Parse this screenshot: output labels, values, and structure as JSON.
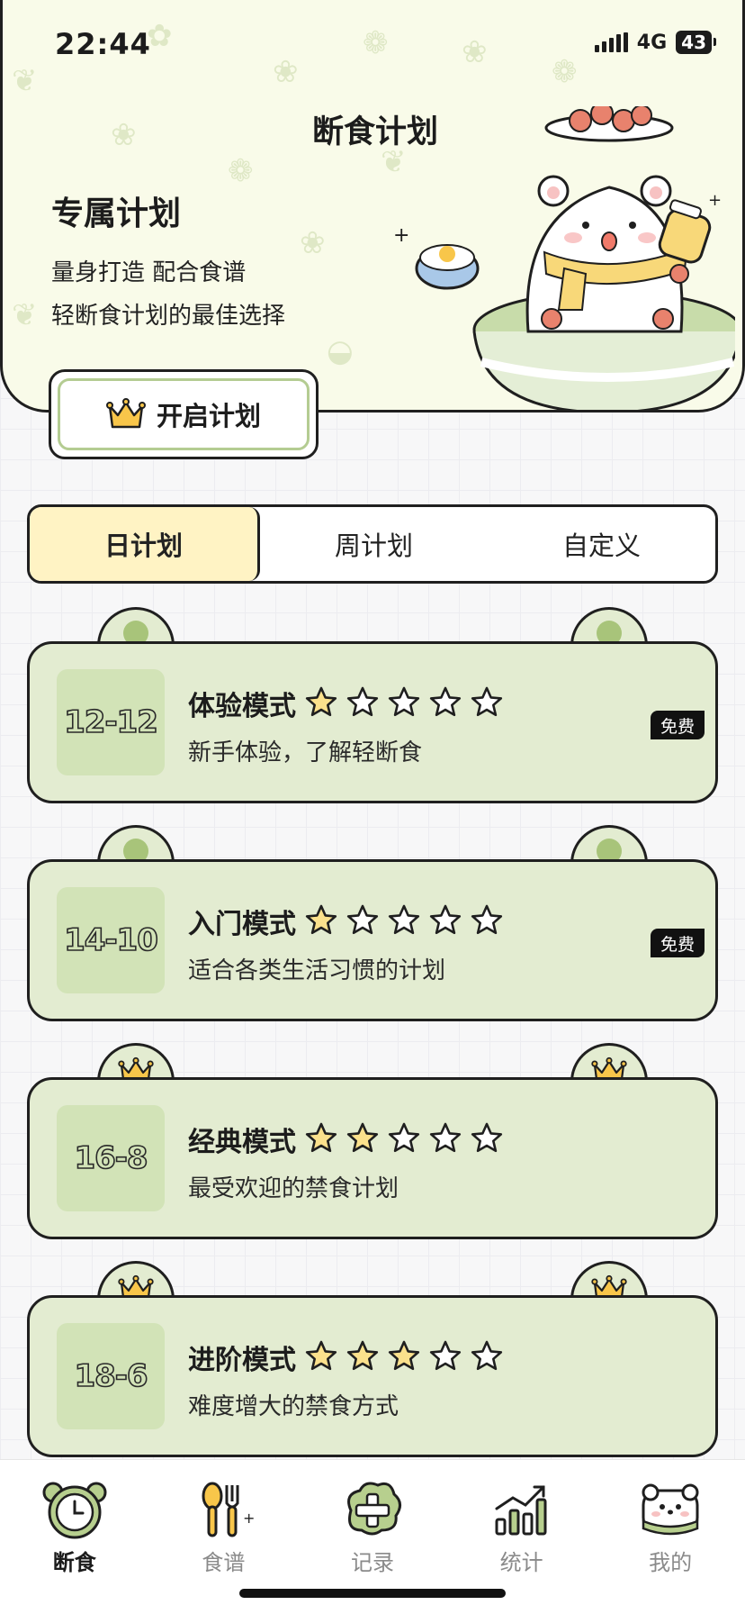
{
  "status_bar": {
    "time": "22:44",
    "network": "4G",
    "battery": "43"
  },
  "header": {
    "title": "断食计划",
    "hero_title": "专属计划",
    "hero_line1": "量身打造 配合食谱",
    "hero_line2": "轻断食计划的最佳选择",
    "start_button": "开启计划"
  },
  "tabs": [
    {
      "label": "日计划",
      "active": true
    },
    {
      "label": "周计划",
      "active": false
    },
    {
      "label": "自定义",
      "active": false
    }
  ],
  "plans": [
    {
      "ratio": "12-12",
      "title": "体验模式",
      "stars": 1,
      "desc": "新手体验，了解轻断食",
      "badge": "免费",
      "ear": "dot"
    },
    {
      "ratio": "14-10",
      "title": "入门模式",
      "stars": 1,
      "desc": "适合各类生活习惯的计划",
      "badge": "免费",
      "ear": "dot"
    },
    {
      "ratio": "16-8",
      "title": "经典模式",
      "stars": 2,
      "desc": "最受欢迎的禁食计划",
      "badge": "",
      "ear": "crown"
    },
    {
      "ratio": "18-6",
      "title": "进阶模式",
      "stars": 3,
      "desc": "难度增大的禁食方式",
      "badge": "",
      "ear": "crown"
    }
  ],
  "bottom_nav": [
    {
      "label": "断食",
      "icon": "clock-icon",
      "active": true
    },
    {
      "label": "食谱",
      "icon": "utensils-icon",
      "active": false
    },
    {
      "label": "记录",
      "icon": "add-record-icon",
      "active": false
    },
    {
      "label": "统计",
      "icon": "stats-icon",
      "active": false
    },
    {
      "label": "我的",
      "icon": "profile-bear-icon",
      "active": false
    }
  ],
  "colors": {
    "card_green": "#e3ecd1",
    "ratio_green": "#d2e3b7",
    "tab_active": "#fff3c4",
    "star_fill": "#fbe18c",
    "outline": "#1f1f1f"
  }
}
